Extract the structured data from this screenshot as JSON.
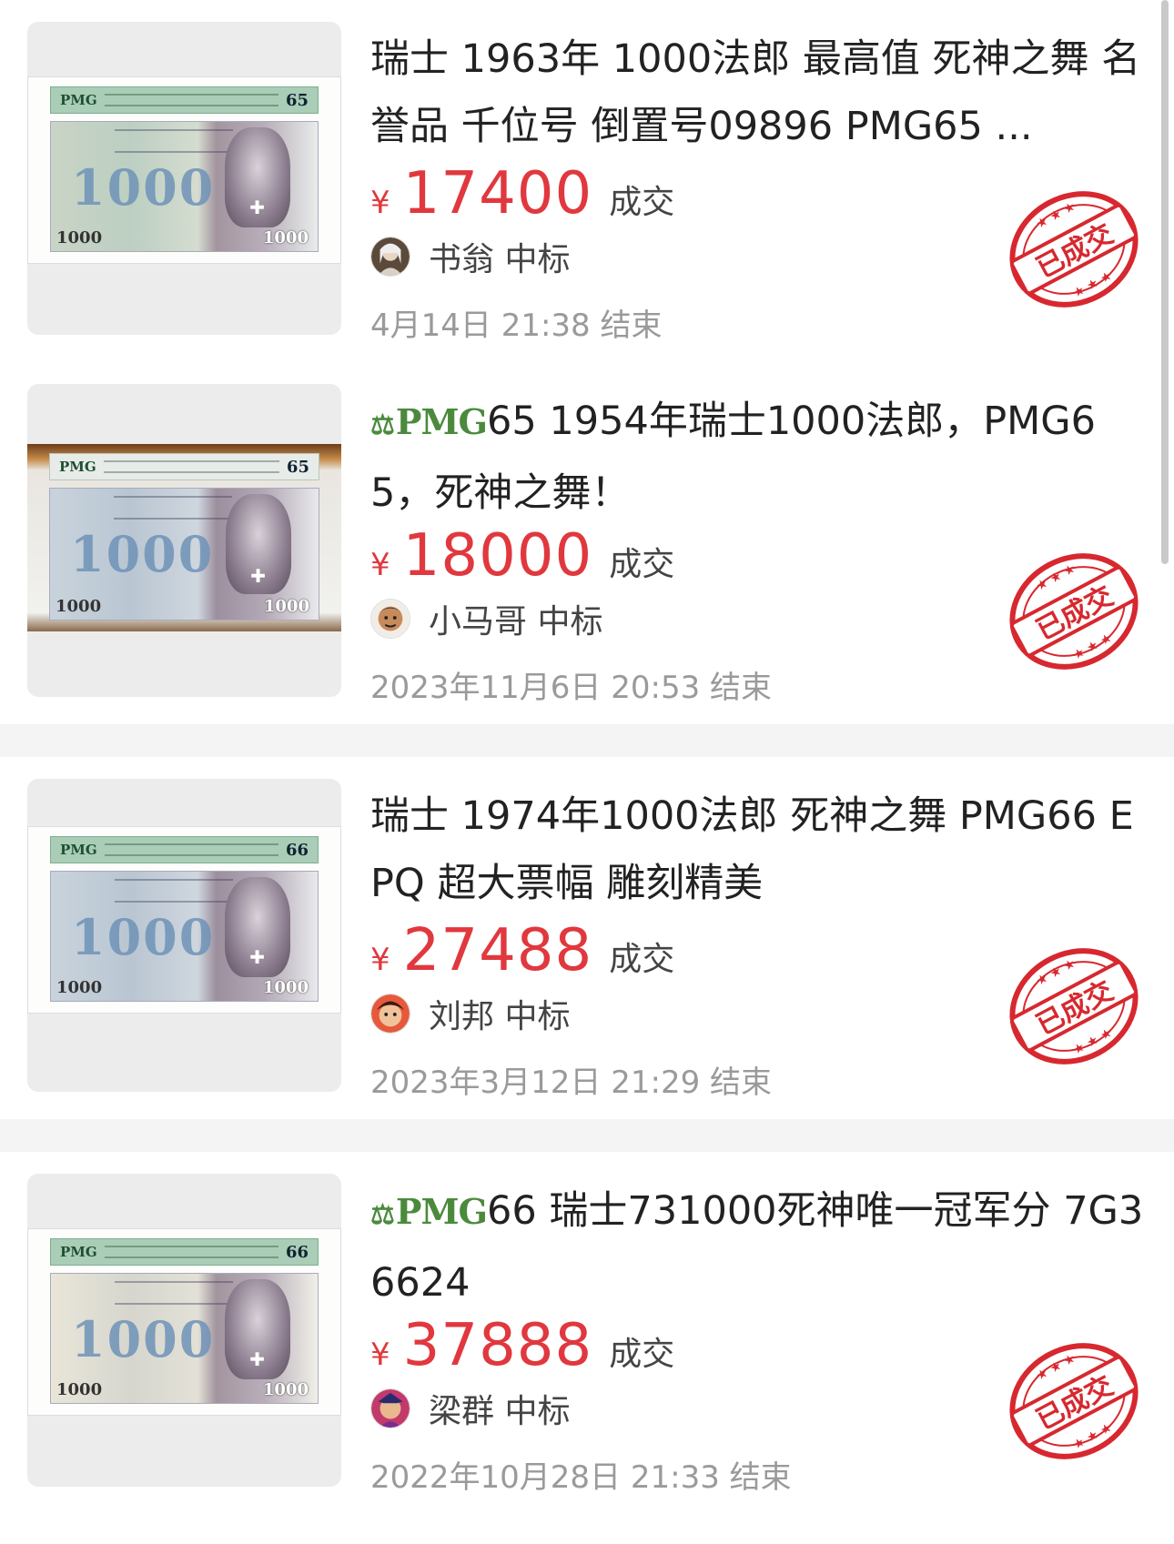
{
  "listings": [
    {
      "has_pmg_logo": false,
      "title": "瑞士 1963年 1000法郎 最高值 死神之舞 名誉品 千位号 倒置号09896 PMG65 ...",
      "currency": "¥",
      "price": "17400",
      "deal_label": "成交",
      "buyer": "书翁 中标",
      "end_time": "4月14日 21:38 结束",
      "stamp_text": "已成交",
      "slab_grade": "65",
      "slab_brand": "PMG"
    },
    {
      "has_pmg_logo": true,
      "logo_text": "PMG",
      "title": "65 1954年瑞士1000法郎，PMG65，死神之舞！",
      "currency": "¥",
      "price": "18000",
      "deal_label": "成交",
      "buyer": "小马哥 中标",
      "end_time": "2023年11月6日 20:53 结束",
      "stamp_text": "已成交",
      "slab_grade": "65",
      "slab_brand": "PMG"
    },
    {
      "has_pmg_logo": false,
      "title": "瑞士 1974年1000法郎 死神之舞 PMG66 EPQ 超大票幅 雕刻精美",
      "currency": "¥",
      "price": "27488",
      "deal_label": "成交",
      "buyer": "刘邦 中标",
      "end_time": "2023年3月12日 21:29 结束",
      "stamp_text": "已成交",
      "slab_grade": "66",
      "slab_brand": "PMG"
    },
    {
      "has_pmg_logo": true,
      "logo_text": "PMG",
      "title": "66 瑞士731000死神唯一冠军分 7G36624",
      "currency": "¥",
      "price": "37888",
      "deal_label": "成交",
      "buyer": "梁群 中标",
      "end_time": "2022年10月28日 21:33 结束",
      "stamp_text": "已成交",
      "slab_grade": "66",
      "slab_brand": "PMG"
    }
  ],
  "banknote": {
    "denomination": "1000"
  },
  "colors": {
    "price_red": "#e0383e",
    "stamp_red": "#d7282f",
    "pmg_green": "#4b8a3d",
    "meta_gray": "#9a9a9a"
  }
}
